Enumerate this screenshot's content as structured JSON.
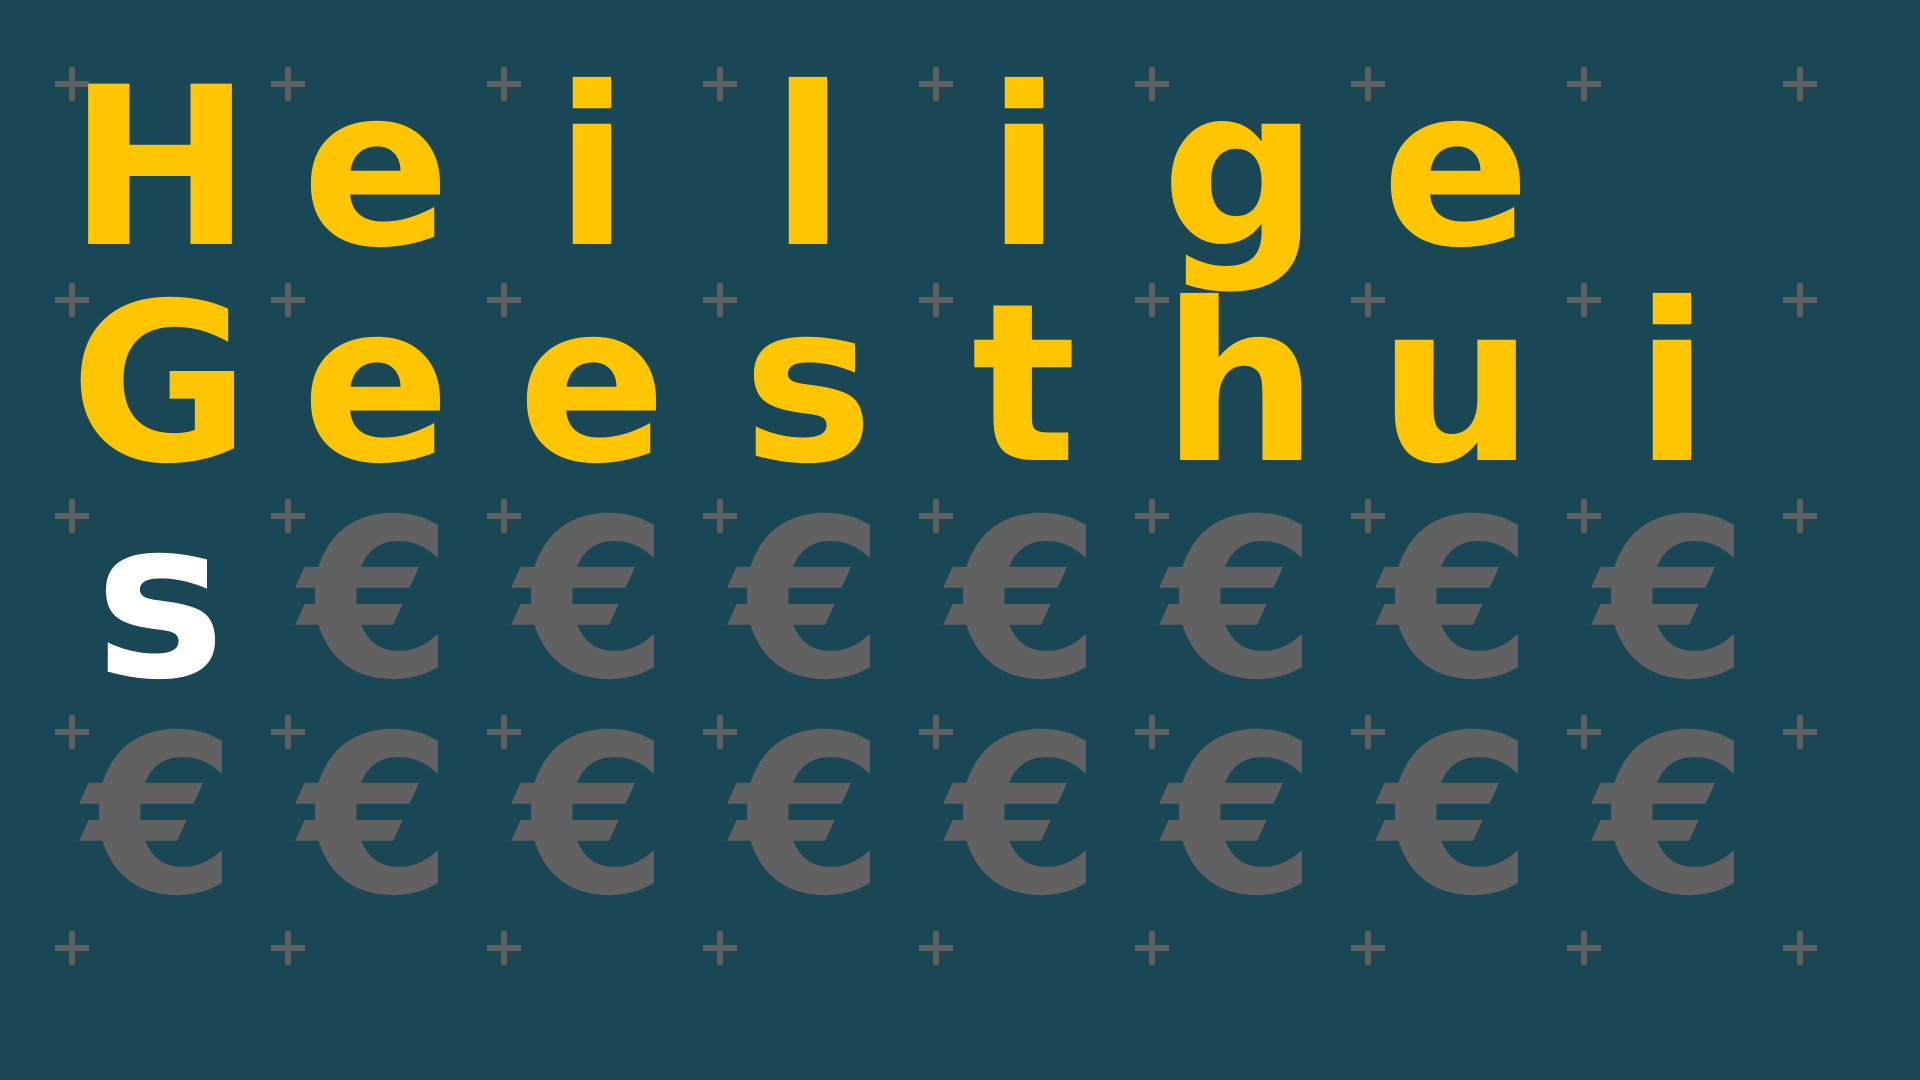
{
  "background_color": "#1a4755",
  "plus_color": "#5f6161",
  "grid": {
    "cols": 9,
    "plus_rows": 5
  },
  "styles": {
    "title": "#ffc600",
    "highlight": "#ffffff",
    "euro": "#616161"
  },
  "rows": [
    [
      {
        "char": "H",
        "style": "title"
      },
      {
        "char": "e",
        "style": "title"
      },
      {
        "char": "i",
        "style": "title"
      },
      {
        "char": "l",
        "style": "title"
      },
      {
        "char": "i",
        "style": "title"
      },
      {
        "char": "g",
        "style": "title"
      },
      {
        "char": "e",
        "style": "title"
      }
    ],
    [
      {
        "char": "G",
        "style": "title"
      },
      {
        "char": "e",
        "style": "title"
      },
      {
        "char": "e",
        "style": "title"
      },
      {
        "char": "s",
        "style": "title"
      },
      {
        "char": "t",
        "style": "title"
      },
      {
        "char": "h",
        "style": "title"
      },
      {
        "char": "u",
        "style": "title"
      },
      {
        "char": "i",
        "style": "title"
      }
    ],
    [
      {
        "char": "s",
        "style": "highlight"
      },
      {
        "char": "€",
        "style": "euro"
      },
      {
        "char": "€",
        "style": "euro"
      },
      {
        "char": "€",
        "style": "euro"
      },
      {
        "char": "€",
        "style": "euro"
      },
      {
        "char": "€",
        "style": "euro"
      },
      {
        "char": "€",
        "style": "euro"
      },
      {
        "char": "€",
        "style": "euro"
      }
    ],
    [
      {
        "char": "€",
        "style": "euro"
      },
      {
        "char": "€",
        "style": "euro"
      },
      {
        "char": "€",
        "style": "euro"
      },
      {
        "char": "€",
        "style": "euro"
      },
      {
        "char": "€",
        "style": "euro"
      },
      {
        "char": "€",
        "style": "euro"
      },
      {
        "char": "€",
        "style": "euro"
      },
      {
        "char": "€",
        "style": "euro"
      }
    ]
  ]
}
